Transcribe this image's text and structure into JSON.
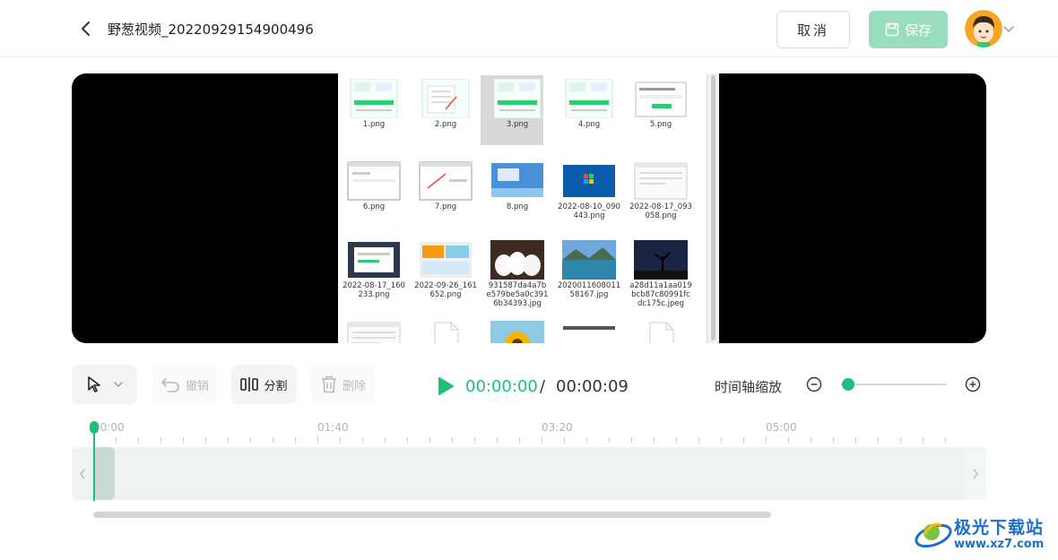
{
  "header": {
    "title": "野葱视频_20220929154900496",
    "cancel_label": "取消",
    "save_label": "保存"
  },
  "preview": {
    "files": [
      {
        "label": "1.png",
        "thumb": "app-green"
      },
      {
        "label": "2.png",
        "thumb": "app-menu"
      },
      {
        "label": "3.png",
        "thumb": "app-green",
        "selected": true
      },
      {
        "label": "4.png",
        "thumb": "app-green"
      },
      {
        "label": "5.png",
        "thumb": "dialog"
      },
      {
        "label": "6.png",
        "thumb": "window"
      },
      {
        "label": "7.png",
        "thumb": "window-arrow"
      },
      {
        "label": "8.png",
        "thumb": "desktop-blue"
      },
      {
        "label": "2022-08-10_090\n443.png",
        "thumb": "windows-logo"
      },
      {
        "label": "2022-08-17_093\n058.png",
        "thumb": "window-light"
      },
      {
        "label": "2022-08-17_160\n233.png",
        "thumb": "window-dark"
      },
      {
        "label": "2022-09-26_161\n652.png",
        "thumb": "collage"
      },
      {
        "label": "931587da4a7b\ne579be5a0c391\n6b34393.jpg",
        "thumb": "puppies"
      },
      {
        "label": "2020011608011\n58167.jpg",
        "thumb": "lake"
      },
      {
        "label": "a28d11a1aa019\nbcb87c80991fc\ndc175c.jpeg",
        "thumb": "night-tree"
      },
      {
        "label": "",
        "thumb": "window-light"
      },
      {
        "label": "",
        "thumb": "blank-file"
      },
      {
        "label": "",
        "thumb": "sunflower"
      },
      {
        "label": "",
        "thumb": "dark-strip"
      },
      {
        "label": "",
        "thumb": "blank-file"
      }
    ]
  },
  "toolbar": {
    "undo_label": "撤销",
    "split_label": "分割",
    "delete_label": "删除"
  },
  "playback": {
    "current_time": "00:00:00",
    "separator": "/",
    "total_time": "00:00:09"
  },
  "zoom": {
    "label": "时间轴缩放",
    "level": 0
  },
  "timeline": {
    "ticks": [
      "00:00",
      "01:40",
      "03:20",
      "05:00"
    ]
  },
  "watermark": {
    "name": "极光下载站",
    "url": "www.xz7.com"
  },
  "colors": {
    "accent": "#1fbf7a",
    "save_disabled": "#9adcbe",
    "watermark": "#1d6fc7"
  }
}
